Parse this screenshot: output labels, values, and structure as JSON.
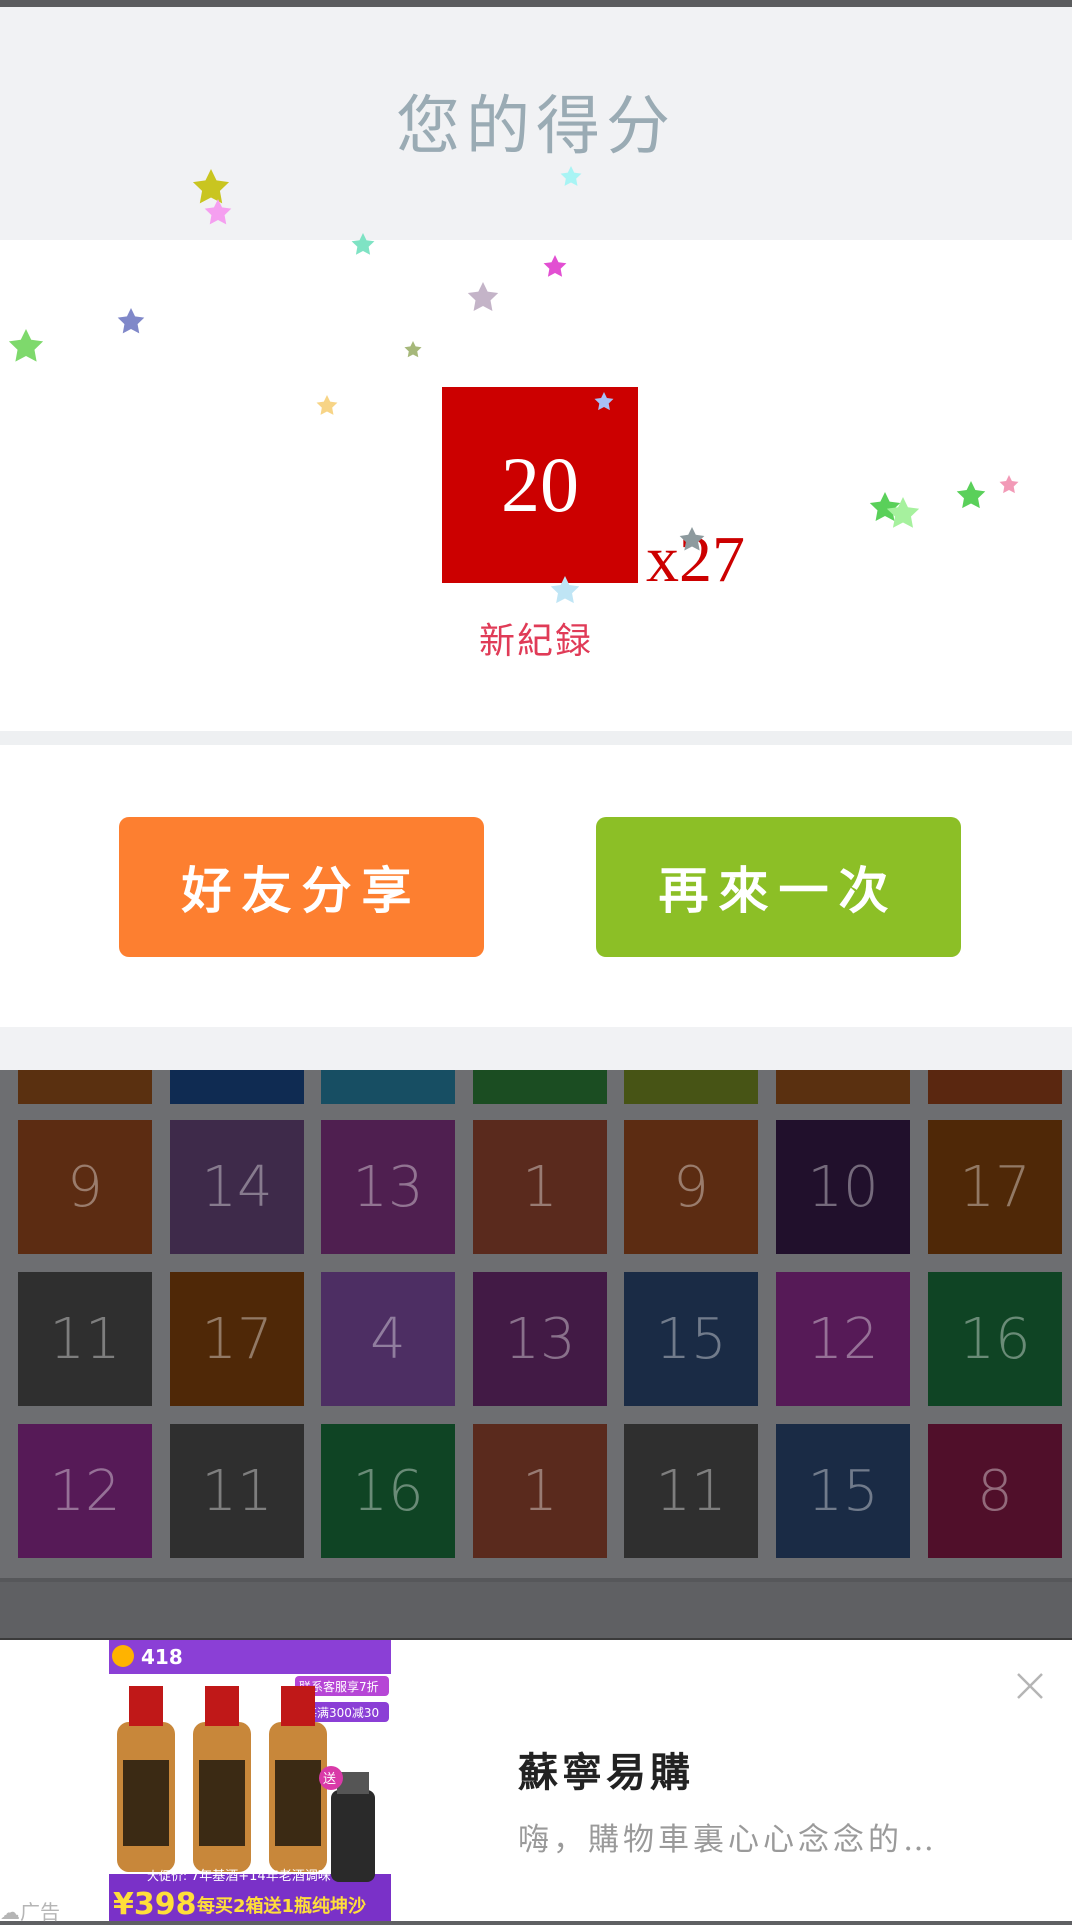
{
  "header": {
    "title": "您的得分"
  },
  "score": {
    "value": "20",
    "combo": "x27",
    "record_label": "新紀録"
  },
  "buttons": {
    "share": "好友分享",
    "retry": "再來一次"
  },
  "board": {
    "partial_row": [
      "#5a3010",
      "#0f2b52",
      "#174e63",
      "#1b4d22",
      "#475415",
      "#5a3010",
      "#5a2710"
    ],
    "rows": [
      [
        {
          "n": "9",
          "c": "#5c2c12"
        },
        {
          "n": "14",
          "c": "#3e2a4a"
        },
        {
          "n": "13",
          "c": "#4f1f50"
        },
        {
          "n": "1",
          "c": "#5a2a1d"
        },
        {
          "n": "9",
          "c": "#5c2c12"
        },
        {
          "n": "10",
          "c": "#21102c"
        },
        {
          "n": "17",
          "c": "#4f2807"
        }
      ],
      [
        {
          "n": "11",
          "c": "#2f2f2f"
        },
        {
          "n": "17",
          "c": "#4f2807"
        },
        {
          "n": "4",
          "c": "#4d2e63"
        },
        {
          "n": "13",
          "c": "#421a45"
        },
        {
          "n": "15",
          "c": "#1a2b45"
        },
        {
          "n": "12",
          "c": "#561a57"
        },
        {
          "n": "16",
          "c": "#0f4424"
        }
      ],
      [
        {
          "n": "12",
          "c": "#561a57"
        },
        {
          "n": "11",
          "c": "#2f2f2f"
        },
        {
          "n": "16",
          "c": "#0f4424"
        },
        {
          "n": "1",
          "c": "#5a2a1d"
        },
        {
          "n": "11",
          "c": "#2f2f2f"
        },
        {
          "n": "15",
          "c": "#1a2b45"
        },
        {
          "n": "8",
          "c": "#500f2a"
        }
      ]
    ]
  },
  "ad": {
    "title": "蘇寧易購",
    "description": "嗨，購物車裏心心念念的…",
    "badge": "广告",
    "image_texts": {
      "campaign": "418",
      "promo1": "联系客服享7折",
      "promo2": "每满300减30",
      "price_label": "大促价:",
      "price_desc": "7年基酒+14年老酒调味",
      "price": "¥398",
      "offer": "每买2箱送1瓶纯坤沙",
      "gift": "送"
    }
  }
}
